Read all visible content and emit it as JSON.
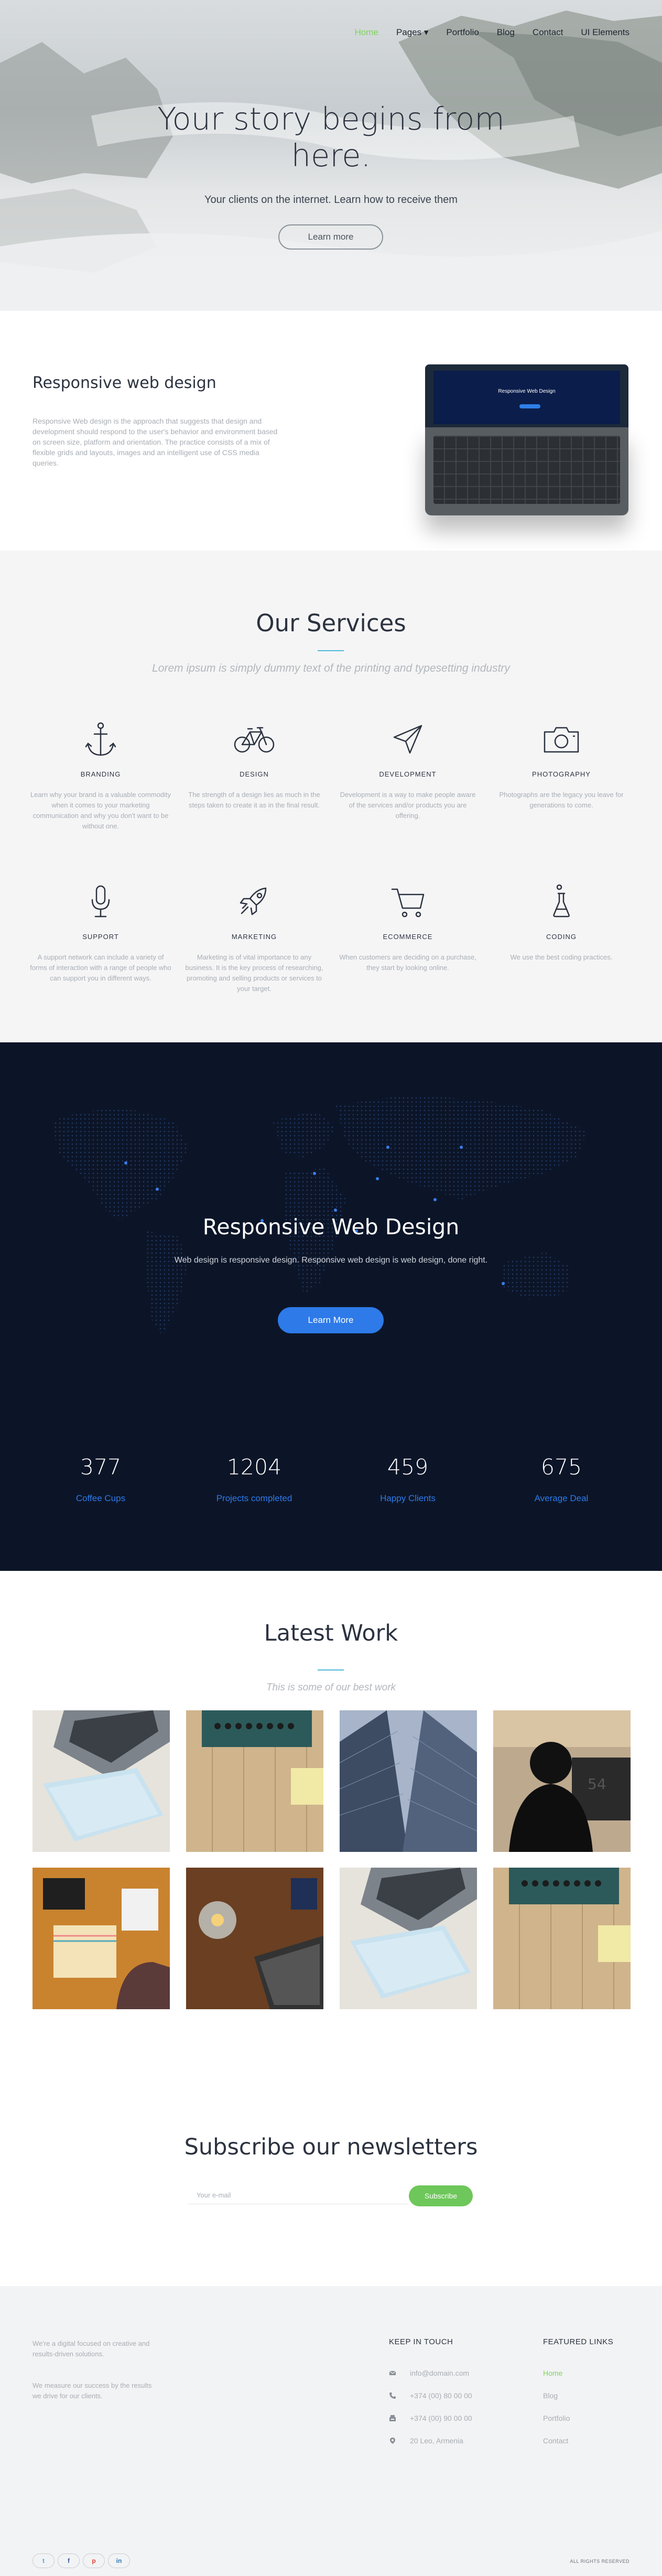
{
  "nav": {
    "items": [
      "Home",
      "Pages ▾",
      "Portfolio",
      "Blog",
      "Contact",
      "UI Elements"
    ]
  },
  "hero": {
    "title": "Your story begins from here.",
    "subtitle": "Your clients on the internet. Learn how to receive them",
    "button": "Learn more"
  },
  "intro": {
    "title": "Responsive web design",
    "text": "Responsive Web design is the approach that suggests that design and development should respond to the user's behavior and environment based on screen size, platform and orientation. The practice consists of a mix of flexible grids and layouts, images and an intelligent use of CSS media queries.",
    "laptop_screen_title": "Responsive Web Design"
  },
  "services": {
    "title": "Our Services",
    "tagline": "Lorem ipsum is simply dummy text of the printing and typesetting industry",
    "items": [
      {
        "name": "BRANDING",
        "icon": "anchor-icon",
        "desc": "Learn why your brand is a valuable commodity when it comes to your marketing communication and why you don't want to be without one."
      },
      {
        "name": "DESIGN",
        "icon": "bicycle-icon",
        "desc": "The strength of a design lies as much in the steps taken to create it as in the final result."
      },
      {
        "name": "DEVELOPMENT",
        "icon": "paper-plane-icon",
        "desc": "Development is a way to make people aware of the services and/or products you are offering."
      },
      {
        "name": "PHOTOGRAPHY",
        "icon": "camera-icon",
        "desc": "Photographs are the legacy you leave for generations to come."
      },
      {
        "name": "SUPPORT",
        "icon": "microphone-icon",
        "desc": "A support network can include a variety of forms of interaction with a range of people who can support you in different ways."
      },
      {
        "name": "MARKETING",
        "icon": "rocket-icon",
        "desc": "Marketing is of vital importance to any business. It is the key process of researching, promoting and selling products or services to your target."
      },
      {
        "name": "ECOMMERCE",
        "icon": "cart-icon",
        "desc": "When customers are deciding on a purchase, they start by looking online."
      },
      {
        "name": "CODING",
        "icon": "flask-icon",
        "desc": "We use the best coding practices."
      }
    ]
  },
  "rwd": {
    "title": "Responsive Web Design",
    "subtitle": "Web design is responsive design. Responsive web design is web design, done right.",
    "button": "Learn More",
    "stats": [
      {
        "number": "377",
        "label": "Coffee Cups"
      },
      {
        "number": "1204",
        "label": "Projects completed"
      },
      {
        "number": "459",
        "label": "Happy Clients"
      },
      {
        "number": "675",
        "label": "Average Deal"
      }
    ]
  },
  "work": {
    "title": "Latest Work",
    "tagline": "This is some of our best work"
  },
  "subscribe": {
    "title": "Subscribe our newsletters",
    "placeholder": "Your e-mail",
    "button": "Subscribe"
  },
  "footer": {
    "about": "We're a digital focused on creative and results-driven solutions.",
    "about2": "We measure our success by the results we drive for our clients.",
    "contact_title": "KEEP IN TOUCH",
    "email": "info@domain.com",
    "phone": "+374 (00) 80 00 00",
    "fax": "+374 (00) 90 00 00",
    "address": "20 Leo, Armenia",
    "links_title": "FEATURED LINKS",
    "links": [
      "Home",
      "Blog",
      "Portfolio",
      "Contact"
    ],
    "socials": [
      "t",
      "f",
      "p",
      "in"
    ],
    "rights": "ALL RIGHTS RESERVED"
  },
  "colors": {
    "accent_green": "#7ed65a",
    "accent_blue": "#2d7ae8",
    "dark_navy": "#0c1528"
  }
}
